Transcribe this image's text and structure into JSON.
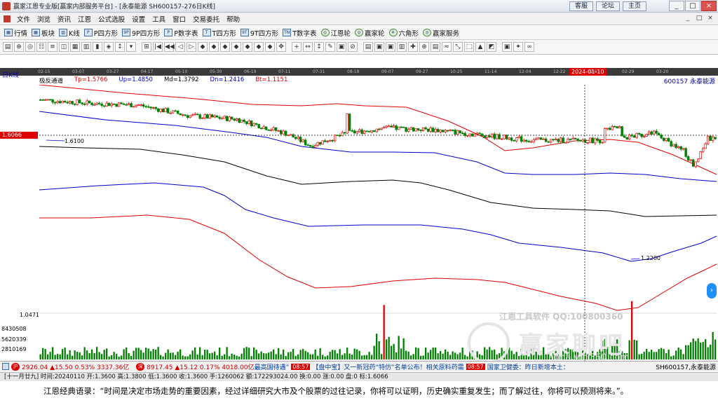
{
  "window": {
    "title": "赢家江恩专业版[赢家内部服务平台] - [永泰能源  SH600157-276日K线]",
    "links": [
      "客服",
      "论坛",
      "主页"
    ],
    "controls": [
      "_",
      "□",
      "×"
    ]
  },
  "menu": {
    "items": [
      "文件",
      "浏览",
      "资讯",
      "江恩",
      "公式选股",
      "设置",
      "工具",
      "窗口",
      "交易委托",
      "帮助"
    ],
    "mdi_controls": [
      "_",
      "□",
      "×"
    ]
  },
  "toolbar1": {
    "items": [
      {
        "icon": "grid-icon",
        "glyph": "▦",
        "label": "行情"
      },
      {
        "icon": "grid-icon",
        "glyph": "▦",
        "label": "板块"
      },
      {
        "icon": "candle-icon",
        "glyph": "▥",
        "label": "K线"
      },
      {
        "icon": "p-box-icon",
        "glyph": "P",
        "label": "P四方形"
      },
      {
        "icon": "p9-box-icon",
        "glyph": "9P",
        "label": "9P四方形"
      },
      {
        "icon": "p-table-icon",
        "glyph": "P",
        "label": "P数字表"
      },
      {
        "icon": "t-box-icon",
        "glyph": "T",
        "label": "T四方形"
      },
      {
        "icon": "t9-box-icon",
        "glyph": "9T",
        "label": "9T四方形"
      },
      {
        "icon": "t-table-icon",
        "glyph": "TN",
        "label": "T数字表"
      },
      {
        "icon": "gann-wheel-icon",
        "glyph": "◎",
        "label": "江恩轮"
      },
      {
        "icon": "winner-wheel-icon",
        "glyph": "◎",
        "label": "赢家轮"
      },
      {
        "icon": "hexagon-icon",
        "glyph": "✡",
        "label": "六角形"
      },
      {
        "icon": "service-icon",
        "glyph": "◎",
        "label": "赢家服务"
      }
    ]
  },
  "toolbar2": {
    "buttons": [
      "▤",
      "⊕",
      "◎",
      "☷",
      "≡",
      "◫",
      "▦",
      "▥",
      "▮",
      "◈",
      "↕",
      "▾",
      "⊞",
      "|◀",
      "◀◀",
      "◁",
      "▷",
      "◆",
      "◆",
      "◆",
      "◆",
      "◆",
      "◆",
      "◆",
      "✥",
      "+",
      "↔",
      "↕",
      "✎",
      "▣",
      "⊘",
      "▤",
      "▣",
      "▣",
      "▥",
      "✚",
      "⊕",
      "▤",
      "≈",
      "⤡",
      "⬚",
      "▲",
      "◩",
      "▣",
      "✦",
      "∞"
    ]
  },
  "date_axis": {
    "labels": [
      "02-15",
      "03-07",
      "03-27",
      "04-17",
      "05-10",
      "05-30",
      "06-19",
      "07-11",
      "07-31",
      "08-18",
      "09-07",
      "09-27",
      "10-25",
      "11-14",
      "12-04",
      "12-22",
      "02-01",
      "02-29",
      "03-20"
    ],
    "highlight": "2024-01-10"
  },
  "chart_header": {
    "period": "日K线",
    "indicator": "极反通道",
    "tp": "Tp=1.5766",
    "up": "Up=1.4850",
    "md": "Md=1.3792",
    "dn": "Dn=1.2416",
    "bt": "Bt=1.1151",
    "stock": "600157  永泰能源"
  },
  "price_marks": {
    "current_tag": "1.6066",
    "high_label": "1.6100",
    "low_label": "1.2200"
  },
  "volume_axis": {
    "top": "1.0471",
    "ticks": [
      "8430508",
      "5620339",
      "2810169"
    ],
    "unit_hint": "×"
  },
  "watermark": {
    "line1": "江恩工具软件  QQ:100800360",
    "brand": "赢家聊吧",
    "url": "liaoba.vici360.com"
  },
  "ticker": {
    "sh_badge": "沪",
    "sh_quote": "2926.04 ▲15.50 0.53% 3337.36亿",
    "sz_badge": "深",
    "sz_quote": "8917.45 ▲15.12 0.17% 4018.00亿",
    "news1": "最高国待遇”",
    "time1": "08:57",
    "news2": "【盘中宝】又一新冠药“特仿”名单公布！相关原料药需",
    "time2": "08:57",
    "news3": "国家卫健委：昨日新增本土：",
    "stock": "SH600157,永泰能源"
  },
  "info": {
    "text": "[十一月廿九] 时间:20240110 开:1.3600 高:1.3800 低:1.3600 收:1.3600 手:1260062 额:172293024.00 换:0.00 涨:0.00 盘:0 标:1.6066"
  },
  "quote": {
    "text": "江恩经典语录：“时间是决定市场走势的重要因素，经过详细研究大市及个股票的过往记录，你将可以证明，历史确实重复发生；而了解过往，你将可以预测将来。”。"
  },
  "colors": {
    "up_candle": "#e00000",
    "down_candle": "#008000",
    "top_band": "#e00000",
    "upper_band": "#0000c8",
    "mid_band": "#000000",
    "lower_band": "#0000c8",
    "bottom_band": "#e00000",
    "volume": "#008000"
  }
}
